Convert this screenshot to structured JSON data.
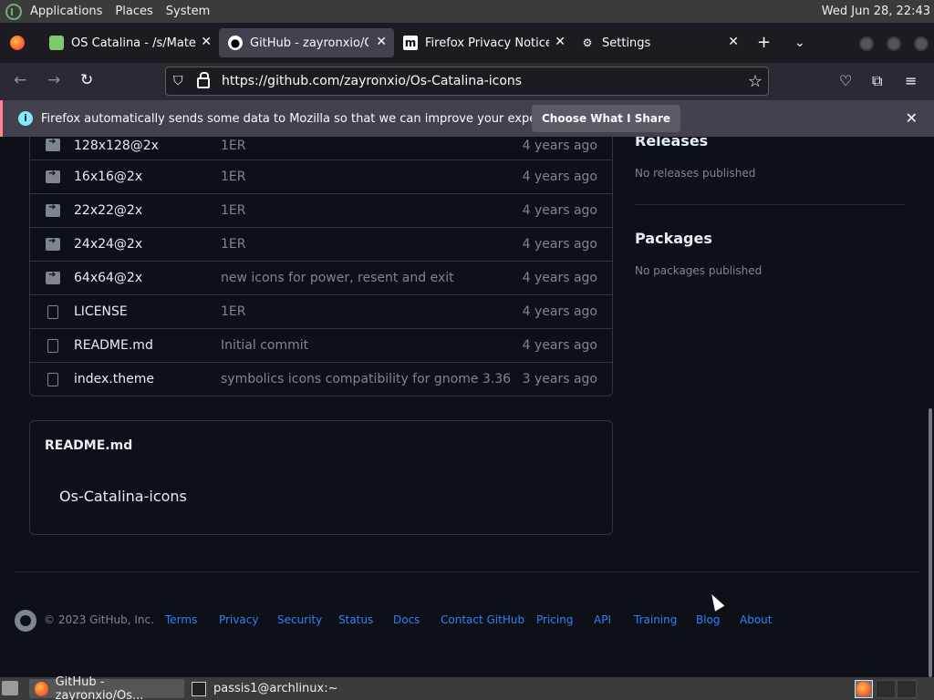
{
  "top_panel": {
    "menus": [
      "Applications",
      "Places",
      "System"
    ],
    "clock": "Wed Jun 28, 22:43"
  },
  "tabs": [
    {
      "label": "OS Catalina - /s/Mate",
      "icon": "catalina-icon"
    },
    {
      "label": "GitHub - zayronxio/Os-Catalina-icons",
      "icon": "github-icon"
    },
    {
      "label": "Firefox Privacy Notice — Mozilla",
      "icon": "mozilla-icon"
    },
    {
      "label": "Settings",
      "icon": "gear-icon"
    }
  ],
  "navbar": {
    "url": "https://github.com/zayronxio/Os-Catalina-icons"
  },
  "notification": {
    "message": "Firefox automatically sends some data to Mozilla so that we can improve your experience.",
    "button": "Choose What I Share"
  },
  "files": [
    {
      "type": "folder",
      "name": "128x128@2x",
      "message": "1ER",
      "date": "4 years ago"
    },
    {
      "type": "folder",
      "name": "16x16@2x",
      "message": "1ER",
      "date": "4 years ago"
    },
    {
      "type": "folder",
      "name": "22x22@2x",
      "message": "1ER",
      "date": "4 years ago"
    },
    {
      "type": "folder",
      "name": "24x24@2x",
      "message": "1ER",
      "date": "4 years ago"
    },
    {
      "type": "folder",
      "name": "64x64@2x",
      "message": "new icons for power, resent and exit",
      "date": "4 years ago"
    },
    {
      "type": "file",
      "name": "LICENSE",
      "message": "1ER",
      "date": "4 years ago"
    },
    {
      "type": "file",
      "name": "README.md",
      "message": "Initial commit",
      "date": "4 years ago"
    },
    {
      "type": "file",
      "name": "index.theme",
      "message": "symbolics icons compatibility for gnome 3.36",
      "date": "3 years ago"
    }
  ],
  "readme": {
    "title": "README.md",
    "heading": "Os-Catalina-icons"
  },
  "sidebar": {
    "releases_title": "Releases",
    "releases_text": "No releases published",
    "packages_title": "Packages",
    "packages_text": "No packages published"
  },
  "footer": {
    "copyright": "© 2023 GitHub, Inc.",
    "links": [
      "Terms",
      "Privacy",
      "Security",
      "Status",
      "Docs",
      "Contact GitHub",
      "Pricing",
      "API",
      "Training",
      "Blog",
      "About"
    ]
  },
  "taskbar": {
    "tasks": [
      "GitHub - zayronxio/Os...",
      "passis1@archlinux:~"
    ]
  },
  "colors": {
    "page_bg": "#0d1117",
    "link": "#2f81f7",
    "muted": "#7d8590",
    "border": "#30363d"
  }
}
